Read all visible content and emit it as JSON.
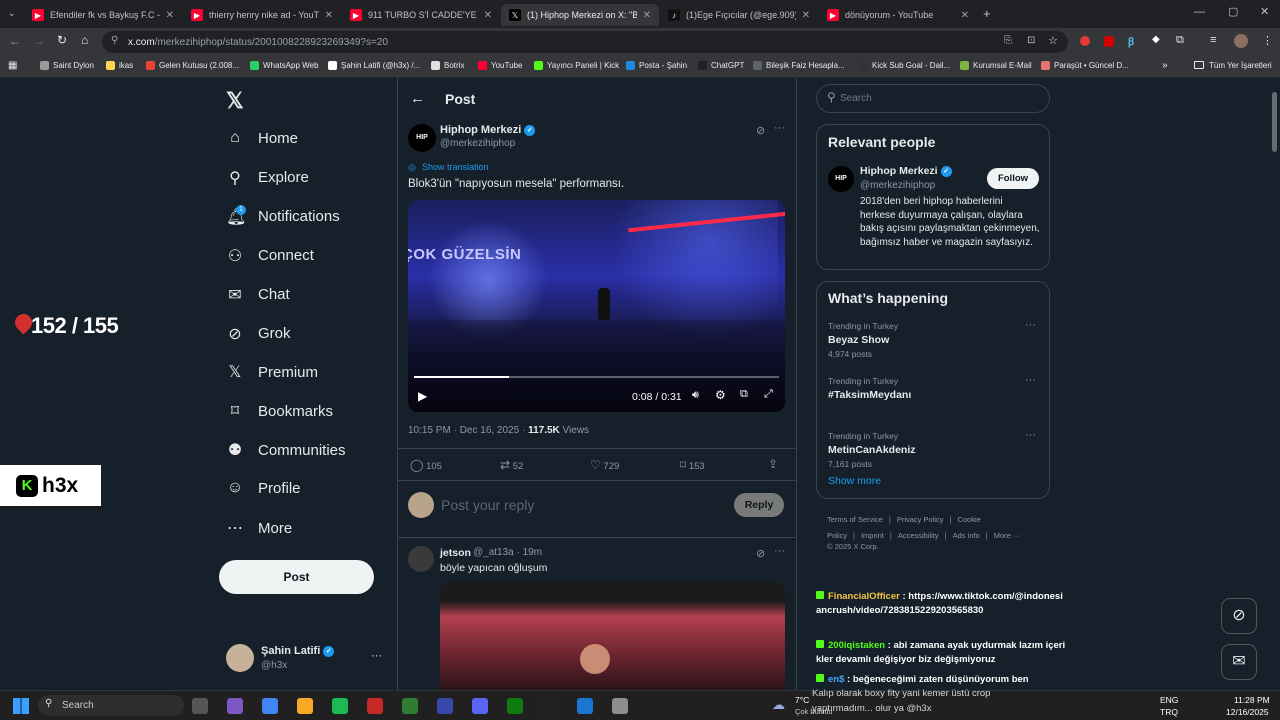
{
  "browser": {
    "tabs": [
      {
        "title": "Efendiler fk vs Baykuş F.C - You",
        "color": "#ff0033",
        "active": false
      },
      {
        "title": "thierry henry nike ad - YouTube",
        "color": "#ff0033",
        "active": false
      },
      {
        "title": "911 TURBO S'İ CADDE'YE İNDİR",
        "color": "#ff0033",
        "active": false
      },
      {
        "title": "(1) Hiphop Merkezi on X: \"Blok3",
        "color": "#000000",
        "active": true
      },
      {
        "title": "(1)Ege Fıçıcılar (@ege.909) | Tik",
        "color": "#111111",
        "active": false
      },
      {
        "title": "dönüyorum - YouTube",
        "color": "#ff0033",
        "active": false
      }
    ],
    "url_host": "x.com",
    "url_path": "/merkezihiphop/status/2001008228923269349?s=20",
    "bookmarks": [
      "Saint Dylon",
      "ikas",
      "Gelen Kutusu (2.008...",
      "WhatsApp Web",
      "Şahin Latifi (@h3x) /...",
      "Botrix",
      "YouTube",
      "Yayıncı Paneli | Kick",
      "Posta - Şahin",
      "ChatGPT",
      "Bileşik Faiz Hesapla...",
      "Kick Sub Goal - Dail...",
      "Kurumsal E-Mail",
      "Paraşüt • Güncel D..."
    ],
    "bookmarks_more": "»",
    "all_bookmarks": "Tüm Yer İşaretleri"
  },
  "overlay": {
    "counter": "152 / 155",
    "brand": "h3x"
  },
  "nav": {
    "items": [
      "Home",
      "Explore",
      "Notifications",
      "Connect",
      "Chat",
      "Grok",
      "Premium",
      "Bookmarks",
      "Communities",
      "Profile",
      "More"
    ],
    "notif_badge": "1",
    "post_label": "Post",
    "account": {
      "name": "Şahin Latifi",
      "handle": "@h3x",
      "more": "···"
    }
  },
  "main": {
    "header_title": "Post",
    "back": "←",
    "tweet": {
      "author": "Hiphop Merkezi",
      "handle": "@merkezihiphop",
      "show_translation": "Show translation",
      "text": "Blok3'ün \"napıyosun mesela\" performansı.",
      "video_overlay_text": "ÇOK GÜZELSİN",
      "video_time": "0:08 / 0:31",
      "video_progress": 0.26,
      "meta_time": "10:15 PM · Dec 16, 2025 · ",
      "views_count": "117.5K",
      "views_label": " Views",
      "stats": {
        "replies": "105",
        "reposts": "52",
        "likes": "729",
        "bookmarks": "153"
      }
    },
    "reply_placeholder": "Post your reply",
    "reply_button": "Reply",
    "reply": {
      "author": "jetson",
      "handle": "@_at13a · 19m",
      "text": "böyle yapıcan oğluşum"
    }
  },
  "right": {
    "search_placeholder": "Search",
    "relevant": {
      "title": "Relevant people",
      "name": "Hiphop Merkezi",
      "handle": "@merkezihiphop",
      "follow": "Follow",
      "bio": "2018'den beri hiphop haberlerini herkese duyurmaya çalışan, olaylara bakış açısını paylaşmaktan çekinmeyen, bağımsız haber ve magazin sayfasıyız."
    },
    "happening": {
      "title": "What’s happening",
      "trends": [
        {
          "context": "Trending in Turkey",
          "name": "Beyaz Show",
          "posts": "4,974 posts"
        },
        {
          "context": "Trending in Turkey",
          "name": "#TaksimMeydanı",
          "posts": ""
        },
        {
          "context": "Trending in Turkey",
          "name": "MetinCanAkdeniz",
          "posts": "7,161 posts"
        }
      ],
      "show_more": "Show more"
    },
    "footer": [
      "Terms of Service",
      "Privacy Policy",
      "Cookie Policy",
      "Imprint",
      "Accessibility",
      "Ads info",
      "More ···"
    ],
    "copyright": "© 2025 X Corp."
  },
  "stream_chat": [
    {
      "user": "FinancialOfficer",
      "user_color": "#f5c542",
      "msg": "https://www.tiktok.com/@indonesiancrush/video/7283815229203565830"
    },
    {
      "user": "200iqistaken",
      "user_color": "#53fc18",
      "msg": "abi zamana ayak uydurmak lazım içerikler devamlı değişiyor biz değişmiyoruz"
    },
    {
      "user": "en$",
      "user_color": "#3fa9f5",
      "msg": "beğeneceğimi zaten düşünüyorum ben"
    }
  ],
  "ticker": "Kalıp olarak boxy fity yani kemer üstü crop",
  "ticker2": "yaptırmadım... olur ya @h3x",
  "taskbar": {
    "search": "Search",
    "weather_temp": "7°C",
    "weather_desc": "Çok bulutlu",
    "lang1": "ENG",
    "lang2": "TRQ",
    "time": "11:28 PM",
    "date": "12/16/2025"
  },
  "colors": {
    "bg": "#15202b",
    "accent": "#1d9bf0",
    "border": "#38444d"
  }
}
